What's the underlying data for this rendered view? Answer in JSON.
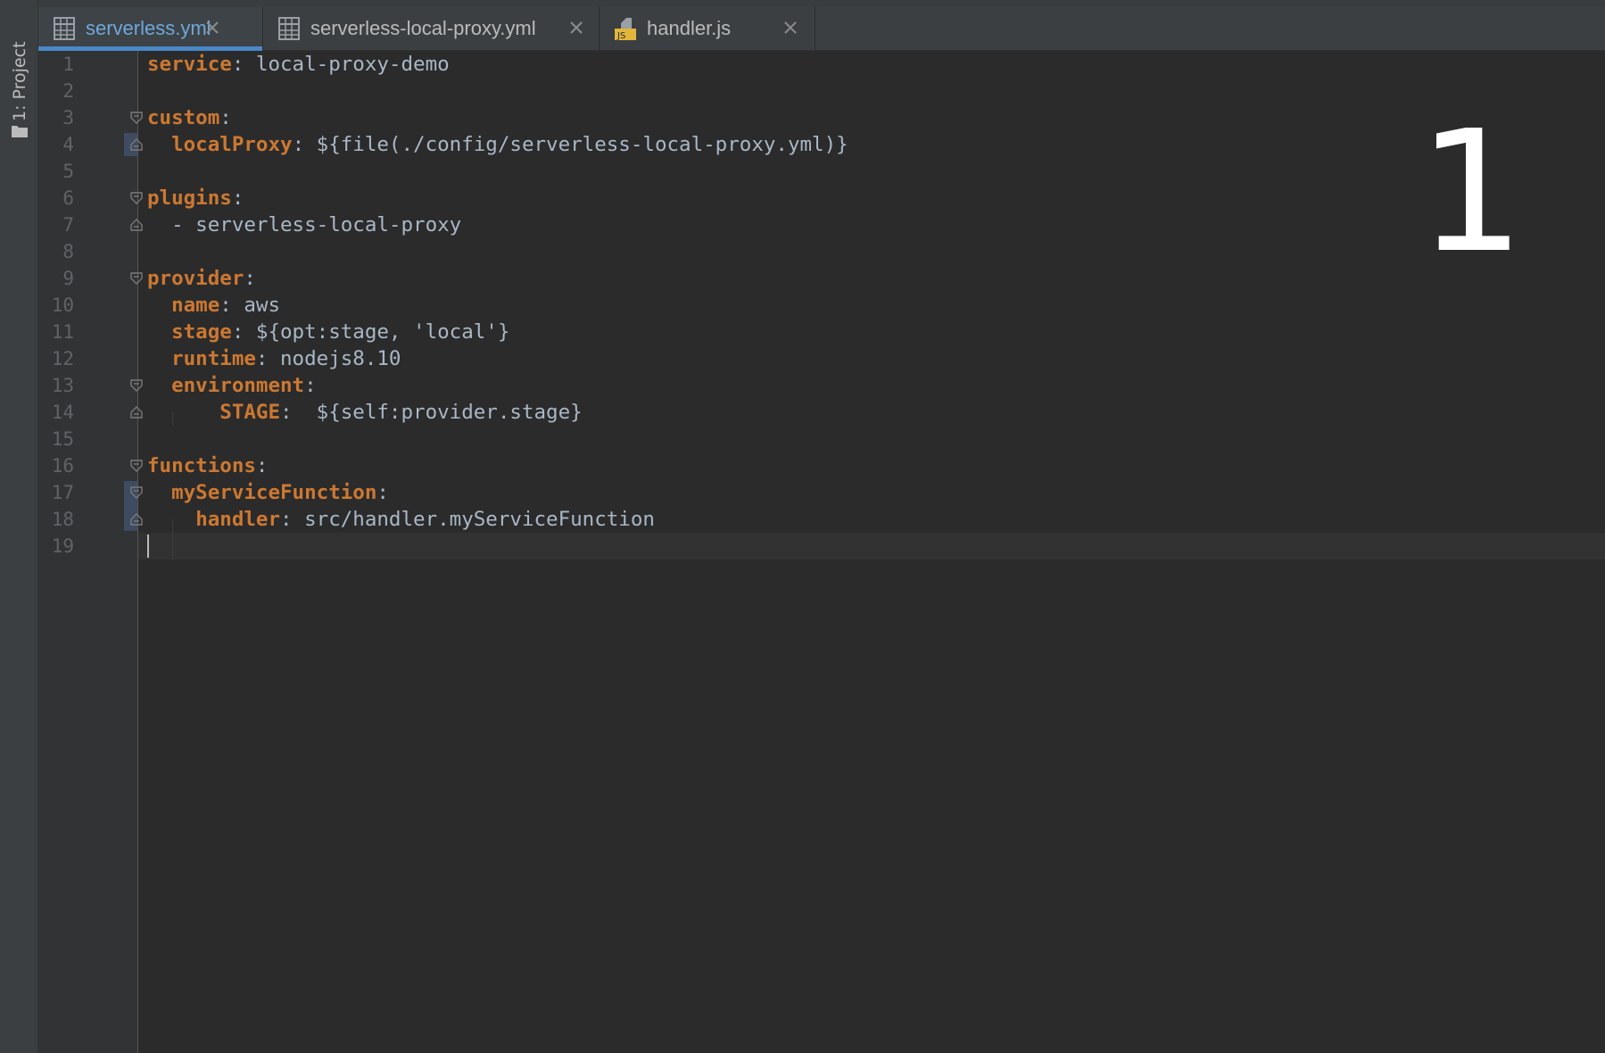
{
  "side_strip": {
    "project_tab_label": "1: Project",
    "icon": "folder-icon"
  },
  "tabs": [
    {
      "label": "serverless.yml",
      "icon": "yaml-file-icon",
      "active": true
    },
    {
      "label": "serverless-local-proxy.yml",
      "icon": "yaml-file-icon",
      "active": false
    },
    {
      "label": "handler.js",
      "icon": "js-file-icon",
      "active": false
    }
  ],
  "js_icon_text": "JS",
  "editor": {
    "current_line": 19,
    "lines": [
      {
        "num": "1",
        "key": "service",
        "sep": ":",
        "value": " local-proxy-demo",
        "indent": ""
      },
      {
        "num": "2",
        "key": "",
        "sep": "",
        "value": "",
        "indent": ""
      },
      {
        "num": "3",
        "key": "custom",
        "sep": ":",
        "value": "",
        "indent": ""
      },
      {
        "num": "4",
        "key": "localProxy",
        "sep": ":",
        "value": " ${file(./config/serverless-local-proxy.yml)}",
        "indent": "  "
      },
      {
        "num": "5",
        "key": "",
        "sep": "",
        "value": "",
        "indent": ""
      },
      {
        "num": "6",
        "key": "plugins",
        "sep": ":",
        "value": "",
        "indent": ""
      },
      {
        "num": "7",
        "key": "",
        "sep": "",
        "value": "- serverless-local-proxy",
        "indent": "  "
      },
      {
        "num": "8",
        "key": "",
        "sep": "",
        "value": "",
        "indent": ""
      },
      {
        "num": "9",
        "key": "provider",
        "sep": ":",
        "value": "",
        "indent": ""
      },
      {
        "num": "10",
        "key": "name",
        "sep": ":",
        "value": " aws",
        "indent": "  "
      },
      {
        "num": "11",
        "key": "stage",
        "sep": ":",
        "value": " ${opt:stage, 'local'}",
        "indent": "  "
      },
      {
        "num": "12",
        "key": "runtime",
        "sep": ":",
        "value": " nodejs8.10",
        "indent": "  "
      },
      {
        "num": "13",
        "key": "environment",
        "sep": ":",
        "value": "",
        "indent": "  "
      },
      {
        "num": "14",
        "key": "STAGE",
        "sep": ":",
        "value": "  ${self:provider.stage}",
        "indent": "      "
      },
      {
        "num": "15",
        "key": "",
        "sep": "",
        "value": "",
        "indent": ""
      },
      {
        "num": "16",
        "key": "functions",
        "sep": ":",
        "value": "",
        "indent": ""
      },
      {
        "num": "17",
        "key": "myServiceFunction",
        "sep": ":",
        "value": "",
        "indent": "  "
      },
      {
        "num": "18",
        "key": "handler",
        "sep": ":",
        "value": " src/handler.myServiceFunction",
        "indent": "    "
      },
      {
        "num": "19",
        "key": "",
        "sep": "",
        "value": "",
        "indent": ""
      }
    ]
  },
  "overlay_number": "1",
  "colors": {
    "key": "#cc7832",
    "value": "#a9b7c6",
    "active_tab_text": "#6fa8dc",
    "active_tab_underline": "#4a88c7"
  }
}
